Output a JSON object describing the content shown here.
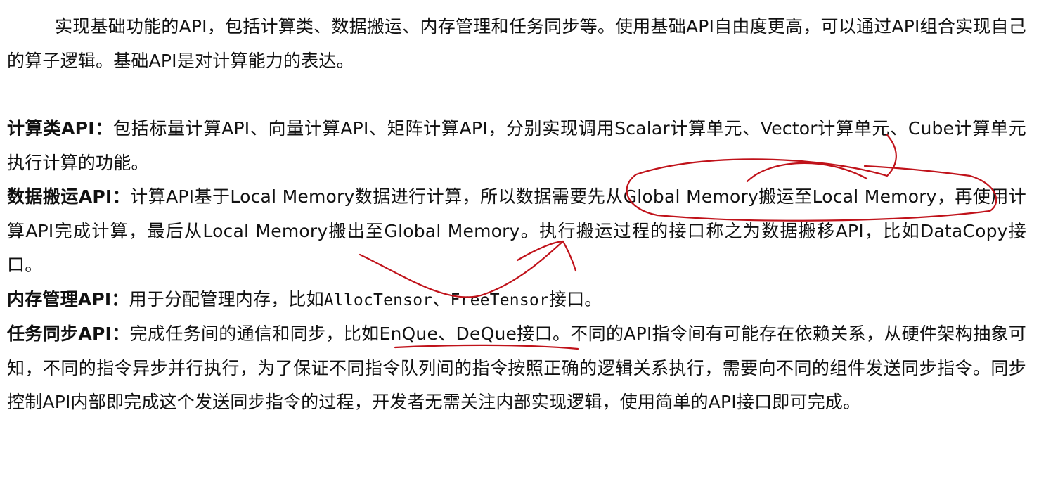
{
  "intro": {
    "line": "实现基础功能的API，包括计算类、数据搬运、内存管理和任务同步等。使用基础API自由度更高，可以通过API组合实现自己的算子逻辑。基础API是对计算能力的表达。"
  },
  "compute": {
    "term": "计算类API：",
    "body": "包括标量计算API、向量计算API、矩阵计算API，分别实现调用Scalar计算单元、Vector计算单元、Cube计算单元执行计算的功能。"
  },
  "data_move": {
    "term": "数据搬运API：",
    "body": "计算API基于Local Memory数据进行计算，所以数据需要先从Global Memory搬运至Local Memory，再使用计算API完成计算，最后从Local Memory搬出至Global Memory。执行搬运过程的接口称之为数据搬移API，比如DataCopy接口。"
  },
  "memory": {
    "term": "内存管理API：",
    "prefix": "用于分配管理内存，比如",
    "api1": "AllocTensor",
    "sep": "、",
    "api2": "FreeTensor",
    "suffix": "接口。"
  },
  "sync": {
    "term": "任务同步API：",
    "body": "完成任务间的通信和同步，比如EnQue、DeQue接口。不同的API指令间有可能存在依赖关系，从硬件架构抽象可知，不同的指令异步并行执行，为了保证不同指令队列间的指令按照正确的逻辑关系执行，需要向不同的组件发送同步指令。同步控制API内部即完成这个发送同步指令的过程，开发者无需关注内部实现逻辑，使用简单的API接口即可完成。"
  },
  "annotation": {
    "color": "#c0121a"
  }
}
